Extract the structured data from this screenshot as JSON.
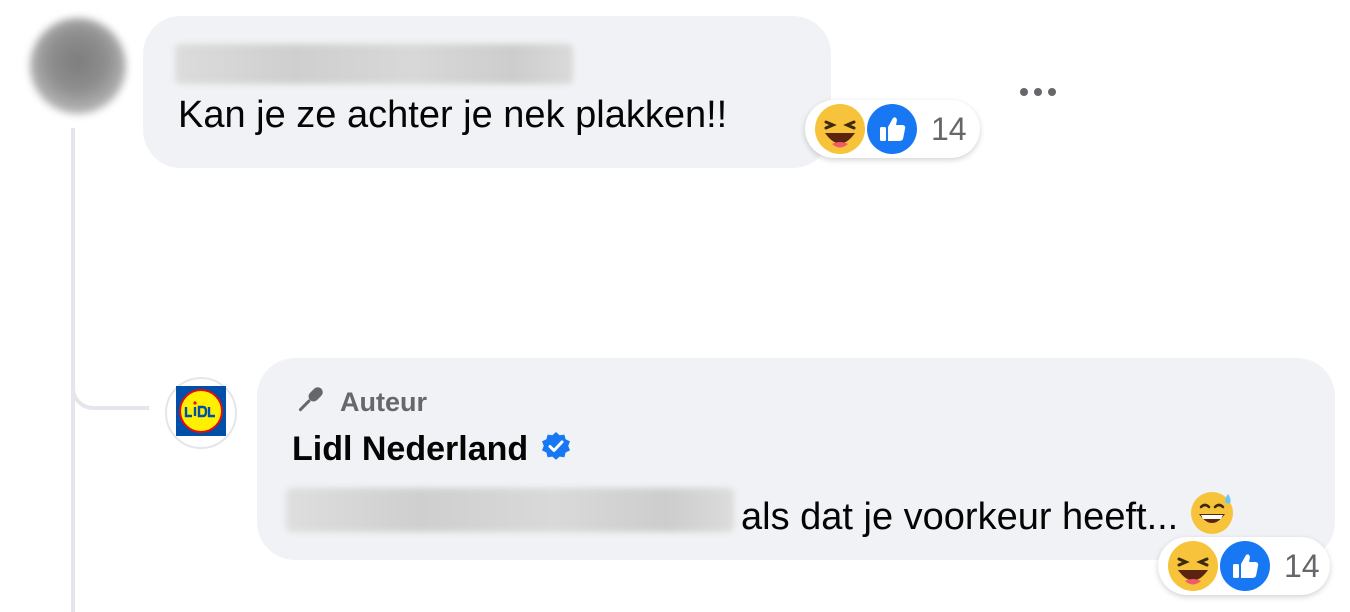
{
  "thread": {
    "comment": {
      "text": "Kan je ze achter je nek plakken!!",
      "reactions": {
        "icons": [
          "laughing-emoji-icon",
          "like-icon"
        ],
        "count": "14"
      }
    },
    "reply": {
      "badge_label": "Auteur",
      "page_name": "Lidl Nederland",
      "text": "als dat je voorkeur heeft...",
      "reactions": {
        "icons": [
          "laughing-emoji-icon",
          "like-icon"
        ],
        "count": "14"
      }
    }
  },
  "colors": {
    "bubble": "#f0f2f5",
    "secondary_text": "#65676b",
    "verified_blue": "#1877f2",
    "like_blue": "#1877f2"
  }
}
